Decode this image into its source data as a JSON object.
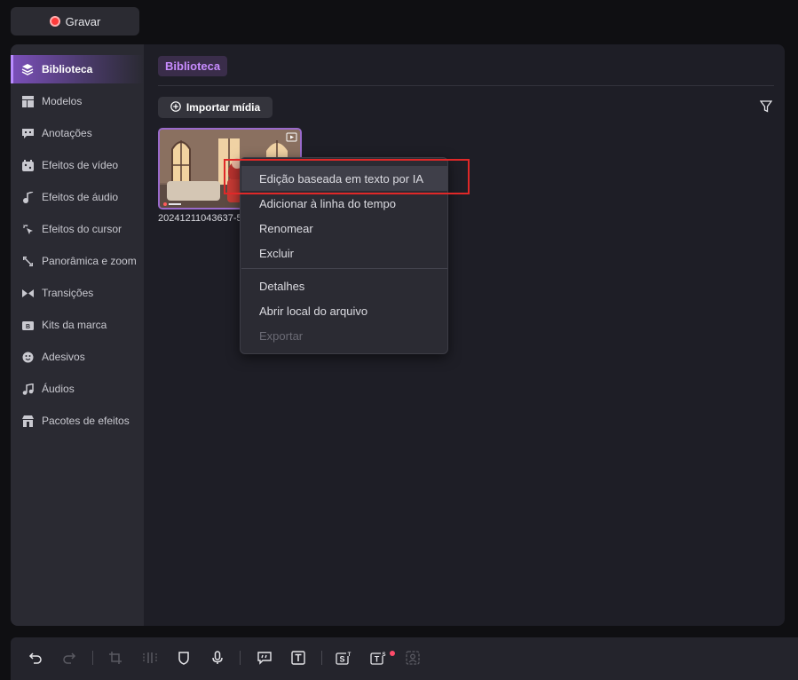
{
  "header": {
    "record_label": "Gravar"
  },
  "sidebar": {
    "items": [
      {
        "label": "Biblioteca",
        "icon": "layers-icon",
        "active": true
      },
      {
        "label": "Modelos",
        "icon": "templates-icon"
      },
      {
        "label": "Anotações",
        "icon": "annotation-icon"
      },
      {
        "label": "Efeitos de vídeo",
        "icon": "video-effects-icon"
      },
      {
        "label": "Efeitos de áudio",
        "icon": "audio-effects-icon"
      },
      {
        "label": "Efeitos do cursor",
        "icon": "cursor-icon"
      },
      {
        "label": "Panorâmica e zoom",
        "icon": "zoom-icon"
      },
      {
        "label": "Transições",
        "icon": "transition-icon"
      },
      {
        "label": "Kits da marca",
        "icon": "brand-kit-icon"
      },
      {
        "label": "Adesivos",
        "icon": "sticker-icon"
      },
      {
        "label": "Áudios",
        "icon": "music-icon"
      },
      {
        "label": "Pacotes de efeitos",
        "icon": "effects-pack-icon"
      }
    ]
  },
  "library": {
    "tab_label": "Biblioteca",
    "import_label": "Importar mídia",
    "media_name": "20241211043637-5"
  },
  "context_menu": {
    "items": [
      {
        "label": "Edição baseada em texto por IA",
        "highlighted": true
      },
      {
        "label": "Adicionar à linha do tempo"
      },
      {
        "label": "Renomear"
      },
      {
        "label": "Excluir"
      },
      {
        "label": "Detalhes"
      },
      {
        "label": "Abrir local do arquivo"
      },
      {
        "label": "Exportar",
        "disabled": true
      }
    ]
  },
  "toolbar": {
    "icons": [
      "undo-icon",
      "redo-icon",
      "crop-icon",
      "split-icon",
      "mask-icon",
      "microphone-icon",
      "caption-icon",
      "text-icon",
      "subtitle-icon",
      "text-to-speech-icon",
      "avatar-icon"
    ]
  },
  "colors": {
    "accent": "#b98cff",
    "record": "#ff3b3b",
    "highlight_box": "#e02828"
  }
}
